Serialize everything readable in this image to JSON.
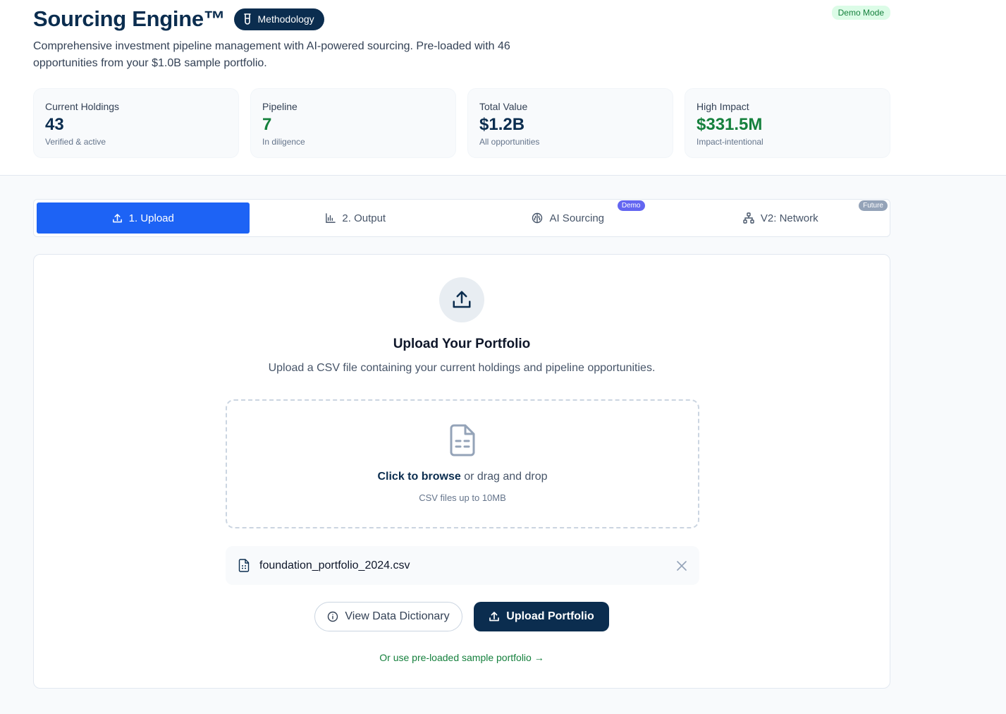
{
  "header": {
    "title": "Sourcing Engine™",
    "methodology_label": "Methodology",
    "mode_badge": "Demo Mode",
    "subtitle": "Comprehensive investment pipeline management with AI-powered sourcing. Pre-loaded with 46 opportunities from your $1.0B sample portfolio."
  },
  "stats": [
    {
      "label": "Current Holdings",
      "value": "43",
      "sub": "Verified & active"
    },
    {
      "label": "Pipeline",
      "value": "7",
      "sub": "In diligence"
    },
    {
      "label": "Total Value",
      "value": "$1.2B",
      "sub": "All opportunities"
    },
    {
      "label": "High Impact",
      "value": "$331.5M",
      "sub": "Impact-intentional"
    }
  ],
  "tabs": [
    {
      "label": "1. Upload",
      "icon": "upload-icon",
      "active": true
    },
    {
      "label": "2. Output",
      "icon": "bar-chart-icon"
    },
    {
      "label": "AI Sourcing",
      "icon": "brain-icon",
      "badge": "Demo"
    },
    {
      "label": "V2: Network",
      "icon": "network-icon",
      "badge": "Future"
    }
  ],
  "upload": {
    "title": "Upload Your Portfolio",
    "description": "Upload a CSV file containing your current holdings and pipeline opportunities.",
    "browse_label": "Click to browse",
    "drag_text": "or drag and drop",
    "hint": "CSV files up to 10MB",
    "file_name": "foundation_portfolio_2024.csv",
    "dictionary_button": "View Data Dictionary",
    "upload_button": "Upload Portfolio",
    "sample_link": "Or use pre-loaded sample portfolio →"
  },
  "colors": {
    "navy": "#0b2d4f",
    "accent_blue": "#1d63f5",
    "green": "#15803d",
    "demo_badge": "#6366f1",
    "future_badge": "#94a3b8"
  }
}
